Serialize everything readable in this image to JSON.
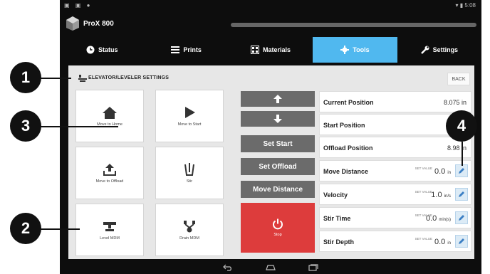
{
  "app": {
    "title": "ProX 800"
  },
  "status_bar": {
    "time": "5:08"
  },
  "tabs": [
    {
      "label": "Status",
      "icon": "clock-icon",
      "active": false
    },
    {
      "label": "Prints",
      "icon": "list-icon",
      "active": false
    },
    {
      "label": "Materials",
      "icon": "grid-icon",
      "active": false
    },
    {
      "label": "Tools",
      "icon": "gear-icon",
      "active": true
    },
    {
      "label": "Settings",
      "icon": "wrench-icon",
      "active": false
    }
  ],
  "panel": {
    "title": "ELEVATOR/LEVELER SETTINGS",
    "back_label": "BACK"
  },
  "grid_buttons": {
    "move_home": "Move to Home",
    "move_start": "Move to Start",
    "move_offload": "Move to Offload",
    "stir": "Stir",
    "level_mdm": "Level MDM",
    "drain_mdm": "Drain MDM"
  },
  "controls": {
    "set_start": "Set Start",
    "set_offload": "Set Offload",
    "move_distance": "Move Distance",
    "stop": "Stop"
  },
  "params": {
    "current_position": {
      "label": "Current Position",
      "value": "8.075 in"
    },
    "start_position": {
      "label": "Start Position",
      "value": ""
    },
    "offload_position": {
      "label": "Offload Position",
      "value": "8.98 in"
    },
    "move_distance": {
      "label": "Move Distance",
      "value": "0.0",
      "unit": "in"
    },
    "velocity": {
      "label": "Velocity",
      "value": "1.0",
      "unit": "in/s"
    },
    "stir_time": {
      "label": "Stir Time",
      "value": "0.0",
      "unit": "min(s)"
    },
    "stir_depth": {
      "label": "Stir Depth",
      "value": "0.0",
      "unit": "in"
    },
    "set_value_label": "SET VALUE"
  },
  "callouts": [
    "1",
    "2",
    "3",
    "4"
  ],
  "colors": {
    "active_tab": "#50b8ef",
    "stop": "#dd3c3c",
    "control": "#6b6b6b"
  }
}
